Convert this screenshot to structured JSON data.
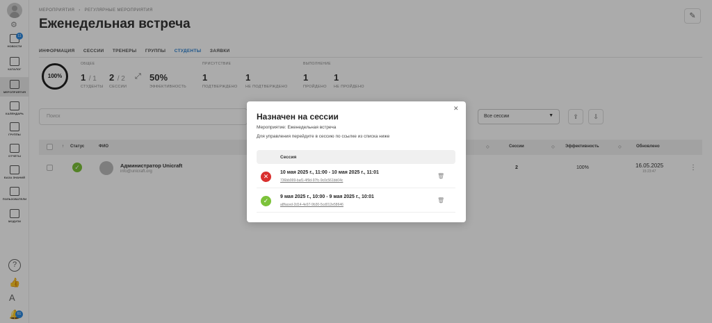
{
  "sidebar": {
    "news_badge": "11",
    "items": [
      {
        "label": "НОВОСТИ"
      },
      {
        "label": "КАТАЛОГ"
      },
      {
        "label": "МЕРОПРИЯТИЯ"
      },
      {
        "label": "КАЛЕНДАРЬ"
      },
      {
        "label": "ГРУППЫ"
      },
      {
        "label": "ОТЧЕТЫ"
      },
      {
        "label": "БАЗА ЗНАНИЙ"
      },
      {
        "label": "ПОЛЬЗОВАТЕЛИ"
      },
      {
        "label": "МОДУЛИ"
      }
    ],
    "bottom_badge": "61"
  },
  "breadcrumb": {
    "part1": "МЕРОПРИЯТИЯ",
    "part2": "РЕГУЛЯРНЫЕ МЕРОПРИЯТИЯ"
  },
  "page": {
    "title": "Еженедельная встреча"
  },
  "tabs": [
    "ИНФОРМАЦИЯ",
    "СЕССИИ",
    "ТРЕНЕРЫ",
    "ГРУППЫ",
    "СТУДЕНТЫ",
    "ЗАЯВКИ"
  ],
  "stats": {
    "ring": "100%",
    "general_head": "ОБЩЕЕ",
    "attendance_head": "ПРИСУТСТВИЕ",
    "completion_head": "ВЫПОЛНЕНИЕ",
    "students_num": "1",
    "students_den": "/ 1",
    "students_cap": "СТУДЕНТЫ",
    "sessions_num": "2",
    "sessions_den": "/ 2",
    "sessions_cap": "СЕССИИ",
    "eff_num": "50%",
    "eff_cap": "ЭФФЕКТИВНОСТЬ",
    "confirmed_num": "1",
    "confirmed_cap": "ПОДТВЕРЖДЕНО",
    "notconfirmed_num": "1",
    "notconfirmed_cap": "НЕ ПОДТВЕРЖДЕНО",
    "passed_num": "1",
    "passed_cap": "ПРОЙДЕНО",
    "notpassed_num": "1",
    "notpassed_cap": "НЕ ПРОЙДЕНО"
  },
  "filters": {
    "search_placeholder": "Поиск",
    "session_select": "Все сессии"
  },
  "table": {
    "headers": {
      "status": "Статус",
      "name": "ФИО",
      "sessions": "Сессии",
      "efficiency": "Эффективность",
      "updated": "Обновлено"
    },
    "rows": [
      {
        "name": "Администратор Unicraft",
        "email": "info@unicraft.org",
        "sessions": "2",
        "efficiency": "100%",
        "updated_date": "16.05.2025",
        "updated_time": "15:23:47"
      }
    ]
  },
  "modal": {
    "title": "Назначен на сессии",
    "event_line": "Мероприятие: Еженедельная встреча",
    "hint_line": "Для управления перейдите в сессию по ссылке из списка ниже",
    "column": "Сессия",
    "sessions": [
      {
        "status": "error",
        "date": "10 мая 2025 г., 11:00 - 10 мая 2025 г., 11:01",
        "id": "736bb999-baf1-4f9d-97fc-9c0c561bb04c"
      },
      {
        "status": "ok",
        "date": "9 мая 2025 г., 10:00 - 9 мая 2025 г., 10:01",
        "id": "a8faced-2d14-4e97-9b30-5cd012e58646"
      }
    ]
  }
}
